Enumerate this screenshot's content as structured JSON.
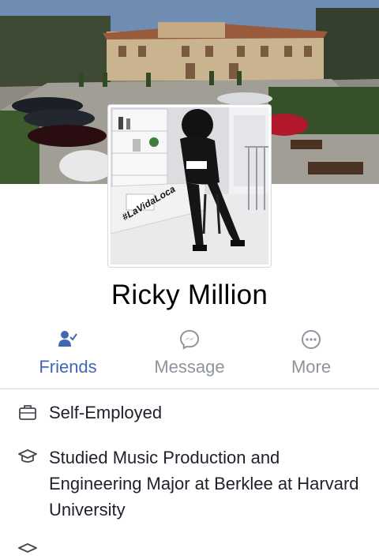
{
  "profile": {
    "name": "Ricky Million",
    "profile_photo_caption": "#LaVidaLoca"
  },
  "actions": [
    {
      "label": "Friends",
      "icon": "friends-check-icon",
      "active": true
    },
    {
      "label": "Message",
      "icon": "messenger-icon",
      "active": false
    },
    {
      "label": "More",
      "icon": "more-dots-icon",
      "active": false
    }
  ],
  "info": [
    {
      "icon": "briefcase-icon",
      "text": "Self-Employed"
    },
    {
      "icon": "graduation-cap-icon",
      "text": "Studied Music Production and Engineering Major at Berklee at Harvard University"
    },
    {
      "icon": "graduation-cap-icon",
      "text": ""
    }
  ],
  "colors": {
    "accent": "#4267b2",
    "muted": "#8d949e",
    "text": "#1d2129",
    "divider": "#d4d6da"
  }
}
